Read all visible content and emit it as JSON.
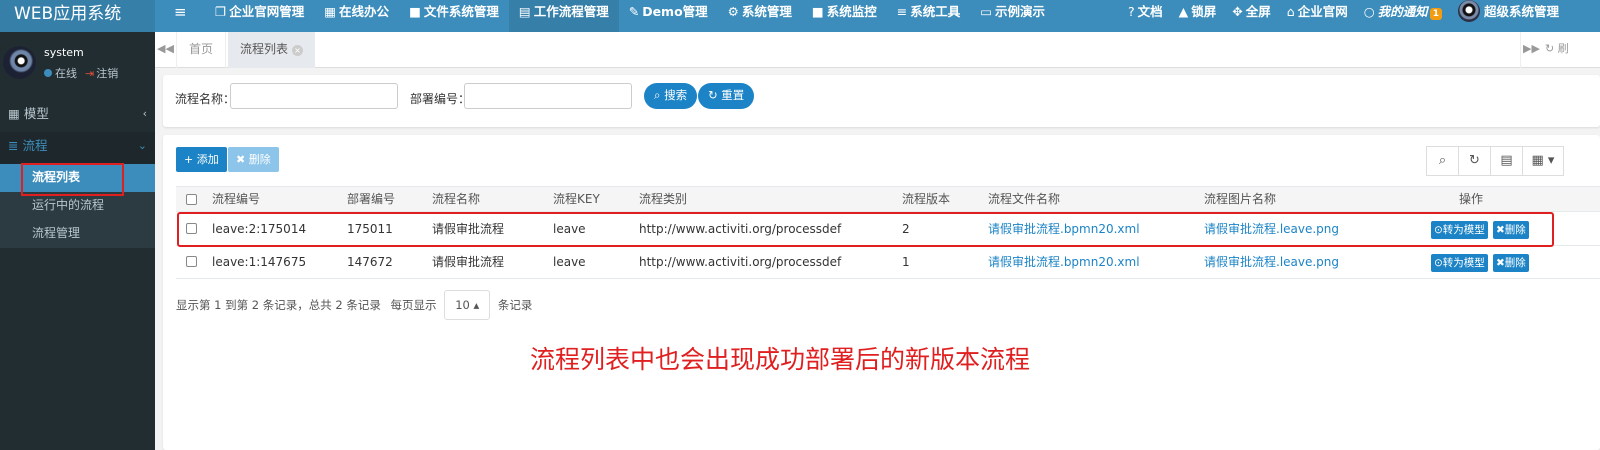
{
  "app": {
    "title": "WEB应用系统"
  },
  "topnav": {
    "toggle_icon": "≡",
    "items": [
      {
        "icon": "❐",
        "label": "企业官网管理"
      },
      {
        "icon": "▦",
        "label": "在线办公"
      },
      {
        "icon": "■",
        "label": "文件系统管理"
      },
      {
        "icon": "▤",
        "label": "工作流程管理"
      },
      {
        "icon": "✎",
        "label": "Demo管理"
      },
      {
        "icon": "⚙",
        "label": "系统管理"
      },
      {
        "icon": "■",
        "label": "系统监控"
      },
      {
        "icon": "≡",
        "label": "系统工具"
      },
      {
        "icon": "▭",
        "label": "示例演示"
      }
    ],
    "active_index": 3,
    "right": [
      {
        "icon": "?",
        "label": "文档"
      },
      {
        "icon": "▲",
        "label": "锁屏"
      },
      {
        "icon": "✥",
        "label": "全屏"
      },
      {
        "icon": "⌂",
        "label": "企业官网"
      },
      {
        "icon": "○",
        "label": "我的通知",
        "badge": "1"
      },
      {
        "icon": "",
        "label": "超级系统管理"
      }
    ]
  },
  "user": {
    "name": "system",
    "status": "在线",
    "logout": "注销"
  },
  "sidebar": {
    "items": [
      {
        "icon": "▦",
        "label": "模型",
        "arrow": "‹"
      },
      {
        "icon": "≣",
        "label": "流程",
        "arrow": "⌄"
      }
    ],
    "subitems": [
      {
        "label": "流程列表",
        "active": true
      },
      {
        "label": "运行中的流程",
        "active": false
      },
      {
        "label": "流程管理",
        "active": false
      }
    ]
  },
  "tabs": {
    "home": "首页",
    "current": "流程列表",
    "close_icon": "×",
    "scroll_left": "◀◀",
    "scroll_right": "▶▶",
    "refresh": "↻ 刷"
  },
  "search": {
    "name_label": "流程名称：",
    "name_value": "",
    "dept_label": "部署编号：",
    "dept_value": "",
    "search_button": "⌕ 搜索",
    "reset_button": "↻ 重置"
  },
  "toolbar": {
    "add_button": "+ 添加",
    "delete_button": "✖ 删除",
    "tools": [
      "⌕",
      "↻",
      "▤",
      "▦ ▾"
    ]
  },
  "table": {
    "headers": [
      "流程编号",
      "部署编号",
      "流程名称",
      "流程KEY",
      "流程类别",
      "流程版本",
      "流程文件名称",
      "流程图片名称",
      "操作"
    ],
    "rows": [
      [
        "leave:2:175014",
        "175011",
        "请假审批流程",
        "leave",
        "http://www.activiti.org/processdef",
        "2",
        "请假审批流程.bpmn20.xml",
        "请假审批流程.leave.png"
      ],
      [
        "leave:1:147675",
        "147672",
        "请假审批流程",
        "leave",
        "http://www.activiti.org/processdef",
        "1",
        "请假审批流程.bpmn20.xml",
        "请假审批流程.leave.png"
      ]
    ],
    "ops": {
      "convert": "⊙转为模型",
      "remove": "✖删除"
    }
  },
  "pager": {
    "summary": "显示第 1 到第 2 条记录，总共 2 条记录",
    "per_page_prefix": "每页显示",
    "per_page_value": "10 ▴",
    "per_page_suffix": "条记录"
  },
  "annotation": "流程列表中也会出现成功部署后的新版本流程",
  "colors": {
    "topbar": "#3c8dbc",
    "sidebar": "#222d32",
    "primary": "#1c84c6",
    "annotation": "#e02020"
  }
}
